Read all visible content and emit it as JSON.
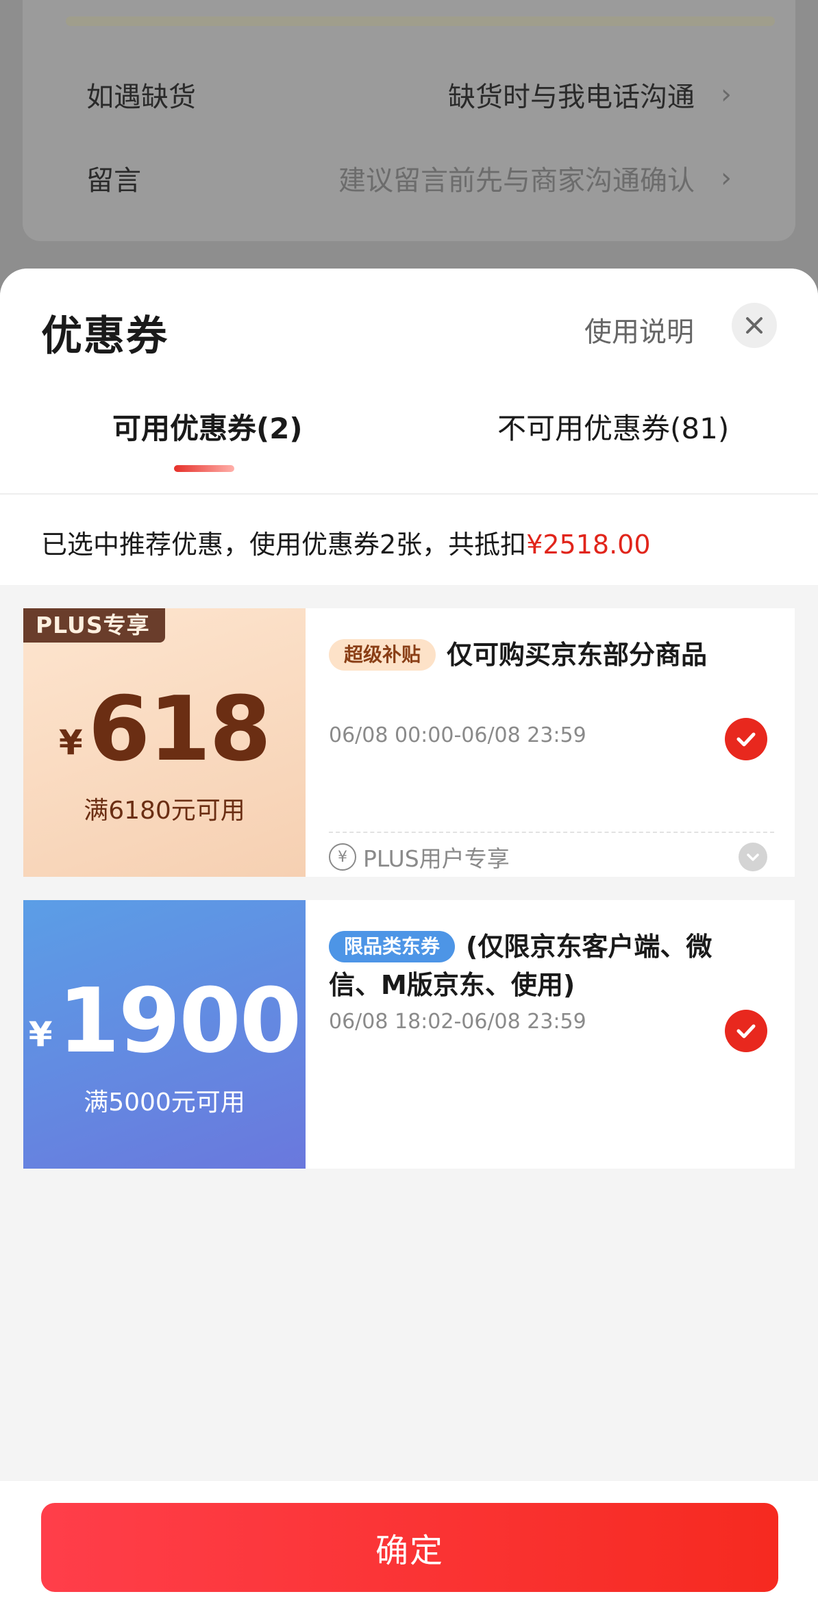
{
  "background_page": {
    "rows": [
      {
        "label": "如遇缺货",
        "value": "缺货时与我电话沟通"
      },
      {
        "label": "留言",
        "placeholder": "建议留言前先与商家沟通确认"
      }
    ]
  },
  "sheet": {
    "title": "优惠券",
    "help_label": "使用说明",
    "tabs": [
      {
        "label": "可用优惠券(2)",
        "active": true
      },
      {
        "label": "不可用优惠券(81)",
        "active": false
      }
    ],
    "summary": {
      "text": "已选中推荐优惠，使用优惠券2张，共抵扣",
      "amount": "¥2518.00"
    },
    "coupons": [
      {
        "tag": "PLUS专享",
        "currency": "¥",
        "amount": "618",
        "condition": "满6180元可用",
        "badge": "超级补贴",
        "description": "仅可购买京东部分商品",
        "validity": "06/08 00:00-06/08 23:59",
        "selected": true,
        "footer_icon": "¥",
        "footer_text": "PLUS用户专享"
      },
      {
        "currency": "¥",
        "amount": "1900",
        "condition": "满5000元可用",
        "badge": "限品类东券",
        "description": "(仅限京东客户端、微信、M版京东、使用)",
        "validity": "06/08 18:02-06/08 23:59",
        "selected": true
      }
    ],
    "confirm_label": "确定"
  },
  "colors": {
    "accent_red": "#e1251b",
    "button_red": "#f62a20",
    "plus_brown": "#6b2e13",
    "blue_coupon": "#5b9ee6"
  },
  "icons": [
    "close-icon",
    "chevron-right-icon",
    "check-icon",
    "yen-circle-icon",
    "chevron-down-icon"
  ]
}
